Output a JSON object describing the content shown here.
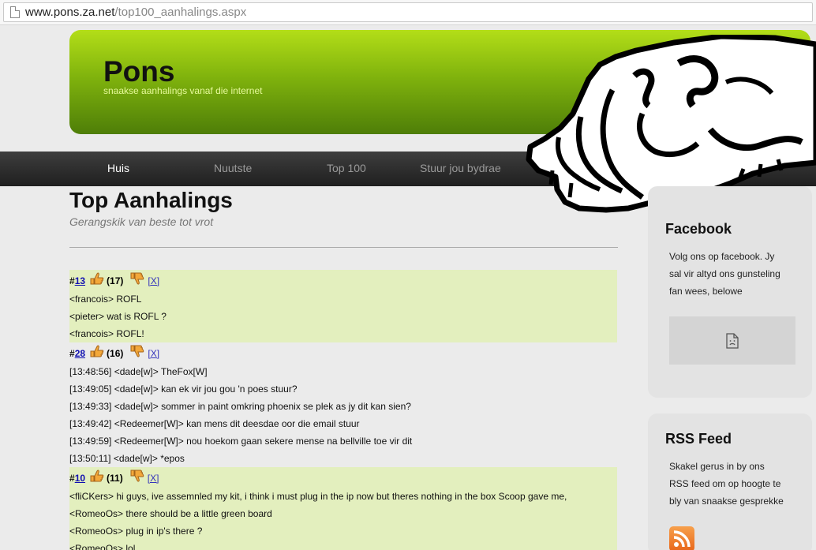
{
  "browser": {
    "url_domain": "www.pons.za.net",
    "url_path": "/top100_aanhalings.aspx"
  },
  "header": {
    "title": "Pons",
    "tagline": "snaakse aanhalings vanaf die internet"
  },
  "nav": {
    "items": [
      "Huis",
      "Nuutste",
      "Top 100",
      "Stuur jou bydrae"
    ],
    "active": "Huis"
  },
  "main": {
    "title": "Top Aanhalings",
    "subtitle": "Gerangskik van beste tot vrot"
  },
  "quotes": [
    {
      "hash": "#",
      "id": "13",
      "score": "(17)",
      "delete": "[X]",
      "lines": [
        "<francois> ROFL",
        "<pieter> wat is ROFL ?",
        "<francois> ROFL!"
      ]
    },
    {
      "hash": "#",
      "id": "28",
      "score": "(16)",
      "delete": "[X]",
      "lines": [
        "[13:48:56] <dade[w]> TheFox[W]",
        "[13:49:05] <dade[w]> kan ek vir jou gou 'n poes stuur?",
        "[13:49:33] <dade[w]> sommer in paint omkring phoenix se plek as jy dit kan sien?",
        "[13:49:42] <Redeemer[W]> kan mens dit deesdae oor die email stuur",
        "[13:49:59] <Redeemer[W]> nou hoekom gaan sekere mense na bellville toe vir dit",
        "[13:50:11] <dade[w]> *epos"
      ]
    },
    {
      "hash": "#",
      "id": "10",
      "score": "(11)",
      "delete": "[X]",
      "lines": [
        "<fliCKers> hi guys, ive assemnled my kit, i think i must plug in the ip now but theres nothing in the box Scoop gave me,",
        "<RomeoOs> there should be a little green board",
        "<RomeoOs> plug in ip's there ?",
        "<RomeoOs> lol"
      ]
    }
  ],
  "sidebar": {
    "facebook": {
      "title": "Facebook",
      "lines": [
        "Volg ons op facebook. Jy",
        "sal vir altyd ons gunsteling",
        "fan wees, belowe"
      ]
    },
    "rss": {
      "title": "RSS Feed",
      "lines": [
        "Skakel gerus in by ons",
        "RSS feed om op hoogte te",
        "bly van snaakse gesprekke"
      ]
    }
  },
  "icons": {
    "thumbs_up": "thumbs-up-icon",
    "thumbs_down": "thumbs-down-icon",
    "broken_plugin": "broken-plugin-icon",
    "rss": "rss-icon"
  },
  "colors": {
    "header_top": "#b3de18",
    "header_bottom": "#4e7e08",
    "highlight_row": "#e3efbe",
    "nav_bg": "#2a2a2a",
    "link": "#1010b0"
  }
}
